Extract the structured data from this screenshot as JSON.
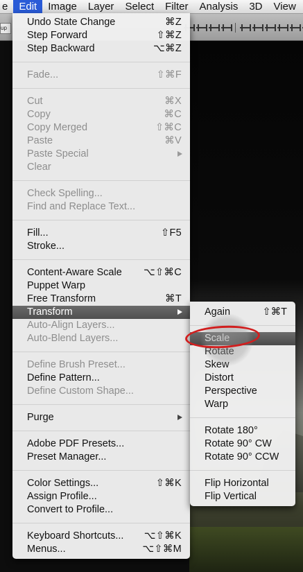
{
  "menubar": {
    "items": [
      {
        "label": "e",
        "active": false
      },
      {
        "label": "Edit",
        "active": true
      },
      {
        "label": "Image",
        "active": false
      },
      {
        "label": "Layer",
        "active": false
      },
      {
        "label": "Select",
        "active": false
      },
      {
        "label": "Filter",
        "active": false
      },
      {
        "label": "Analysis",
        "active": false
      },
      {
        "label": "3D",
        "active": false
      },
      {
        "label": "View",
        "active": false
      }
    ]
  },
  "options_bar": {
    "field_text": "up"
  },
  "edit_menu": {
    "items": [
      {
        "label": "Undo State Change",
        "shortcut": "⌘Z",
        "enabled": true
      },
      {
        "label": "Step Forward",
        "shortcut": "⇧⌘Z",
        "enabled": true
      },
      {
        "label": "Step Backward",
        "shortcut": "⌥⌘Z",
        "enabled": true
      },
      {
        "label": "Fade...",
        "shortcut": "⇧⌘F",
        "enabled": false
      },
      {
        "label": "Cut",
        "shortcut": "⌘X",
        "enabled": false
      },
      {
        "label": "Copy",
        "shortcut": "⌘C",
        "enabled": false
      },
      {
        "label": "Copy Merged",
        "shortcut": "⇧⌘C",
        "enabled": false
      },
      {
        "label": "Paste",
        "shortcut": "⌘V",
        "enabled": false
      },
      {
        "label": "Paste Special",
        "shortcut": "",
        "enabled": false,
        "submenu": true
      },
      {
        "label": "Clear",
        "shortcut": "",
        "enabled": false
      },
      {
        "label": "Check Spelling...",
        "shortcut": "",
        "enabled": false
      },
      {
        "label": "Find and Replace Text...",
        "shortcut": "",
        "enabled": false
      },
      {
        "label": "Fill...",
        "shortcut": "⇧F5",
        "enabled": true
      },
      {
        "label": "Stroke...",
        "shortcut": "",
        "enabled": true
      },
      {
        "label": "Content-Aware Scale",
        "shortcut": "⌥⇧⌘C",
        "enabled": true
      },
      {
        "label": "Puppet Warp",
        "shortcut": "",
        "enabled": true
      },
      {
        "label": "Free Transform",
        "shortcut": "⌘T",
        "enabled": true
      },
      {
        "label": "Transform",
        "shortcut": "",
        "enabled": true,
        "submenu": true,
        "highlighted": true
      },
      {
        "label": "Auto-Align Layers...",
        "shortcut": "",
        "enabled": false
      },
      {
        "label": "Auto-Blend Layers...",
        "shortcut": "",
        "enabled": false
      },
      {
        "label": "Define Brush Preset...",
        "shortcut": "",
        "enabled": false
      },
      {
        "label": "Define Pattern...",
        "shortcut": "",
        "enabled": true
      },
      {
        "label": "Define Custom Shape...",
        "shortcut": "",
        "enabled": false
      },
      {
        "label": "Purge",
        "shortcut": "",
        "enabled": true,
        "submenu": true
      },
      {
        "label": "Adobe PDF Presets...",
        "shortcut": "",
        "enabled": true
      },
      {
        "label": "Preset Manager...",
        "shortcut": "",
        "enabled": true
      },
      {
        "label": "Color Settings...",
        "shortcut": "⇧⌘K",
        "enabled": true
      },
      {
        "label": "Assign Profile...",
        "shortcut": "",
        "enabled": true
      },
      {
        "label": "Convert to Profile...",
        "shortcut": "",
        "enabled": true
      },
      {
        "label": "Keyboard Shortcuts...",
        "shortcut": "⌥⇧⌘K",
        "enabled": true
      },
      {
        "label": "Menus...",
        "shortcut": "⌥⇧⌘M",
        "enabled": true
      }
    ]
  },
  "transform_submenu": {
    "items": [
      {
        "label": "Again",
        "shortcut": "⇧⌘T",
        "enabled": true
      },
      {
        "label": "Scale",
        "shortcut": "",
        "enabled": true,
        "highlighted": true
      },
      {
        "label": "Rotate",
        "shortcut": "",
        "enabled": true
      },
      {
        "label": "Skew",
        "shortcut": "",
        "enabled": true
      },
      {
        "label": "Distort",
        "shortcut": "",
        "enabled": true
      },
      {
        "label": "Perspective",
        "shortcut": "",
        "enabled": true
      },
      {
        "label": "Warp",
        "shortcut": "",
        "enabled": true
      },
      {
        "label": "Rotate 180°",
        "shortcut": "",
        "enabled": true
      },
      {
        "label": "Rotate 90° CW",
        "shortcut": "",
        "enabled": true
      },
      {
        "label": "Rotate 90° CCW",
        "shortcut": "",
        "enabled": true
      },
      {
        "label": "Flip Horizontal",
        "shortcut": "",
        "enabled": true
      },
      {
        "label": "Flip Vertical",
        "shortcut": "",
        "enabled": true
      }
    ]
  },
  "colors": {
    "menubar_active": "#2a5bd7",
    "annotation": "#d11e1e",
    "highlight": "#555555"
  }
}
